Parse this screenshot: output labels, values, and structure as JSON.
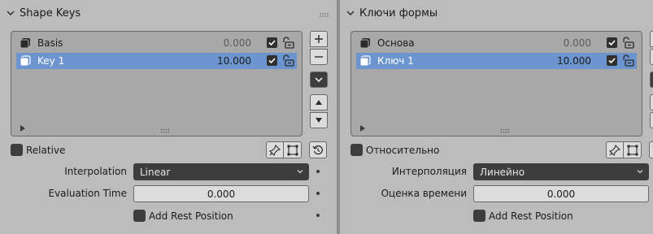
{
  "left": {
    "title": "Shape Keys",
    "keys": [
      {
        "name": "Basis",
        "value": "0.000"
      },
      {
        "name": "Key 1",
        "value": "10.000"
      }
    ],
    "relative_label": "Relative",
    "interpolation_label": "Interpolation",
    "interpolation_value": "Linear",
    "eval_time_label": "Evaluation Time",
    "eval_time_value": "0.000",
    "rest_position_label": "Add Rest Position"
  },
  "right": {
    "title": "Ключи формы",
    "keys": [
      {
        "name": "Основа",
        "value": "0.000"
      },
      {
        "name": "Ключ 1",
        "value": "10.000"
      }
    ],
    "relative_label": "Относительно",
    "interpolation_label": "Интерполяция",
    "interpolation_value": "Линейно",
    "eval_time_label": "Оценка времени",
    "eval_time_value": "0.000",
    "rest_position_label": "Add Rest Position"
  },
  "colors": {
    "panel_bg": "#bcbcbc",
    "list_bg": "#a8a8a8",
    "selected_row": "#6c95cf",
    "dark_widget": "#3d3d3d",
    "light_widget": "#dcdcdc"
  },
  "icons": [
    "chevron-down-icon",
    "shape-key-icon",
    "checkbox-checked-icon",
    "unlock-icon",
    "plus-icon",
    "minus-icon",
    "menu-chevron-icon",
    "arrow-up-icon",
    "arrow-down-icon",
    "pin-icon",
    "edit-mode-icon",
    "reset-icon",
    "drag-grip-icon",
    "expand-icon"
  ]
}
